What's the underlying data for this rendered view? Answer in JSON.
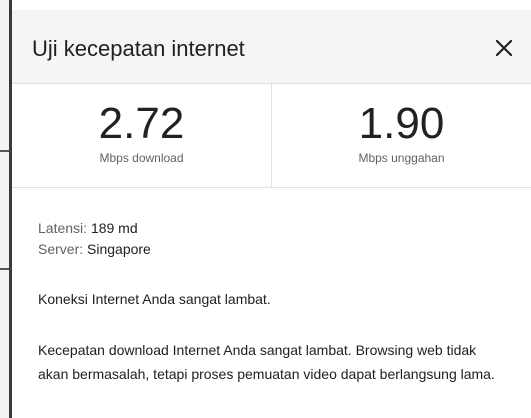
{
  "dialog": {
    "title": "Uji kecepatan internet",
    "close_icon": "close-icon"
  },
  "metrics": {
    "download": {
      "value": "2.72",
      "unit": "Mbps download"
    },
    "upload": {
      "value": "1.90",
      "unit": "Mbps unggahan"
    }
  },
  "details": {
    "latency_label": "Latensi:",
    "latency_value": "189 md",
    "server_label": "Server:",
    "server_value": "Singapore"
  },
  "messages": {
    "summary": "Koneksi Internet Anda sangat lambat.",
    "detail": "Kecepatan download Internet Anda sangat lambat. Browsing web tidak akan bermasalah, tetapi proses pemuatan video dapat berlangsung lama."
  }
}
